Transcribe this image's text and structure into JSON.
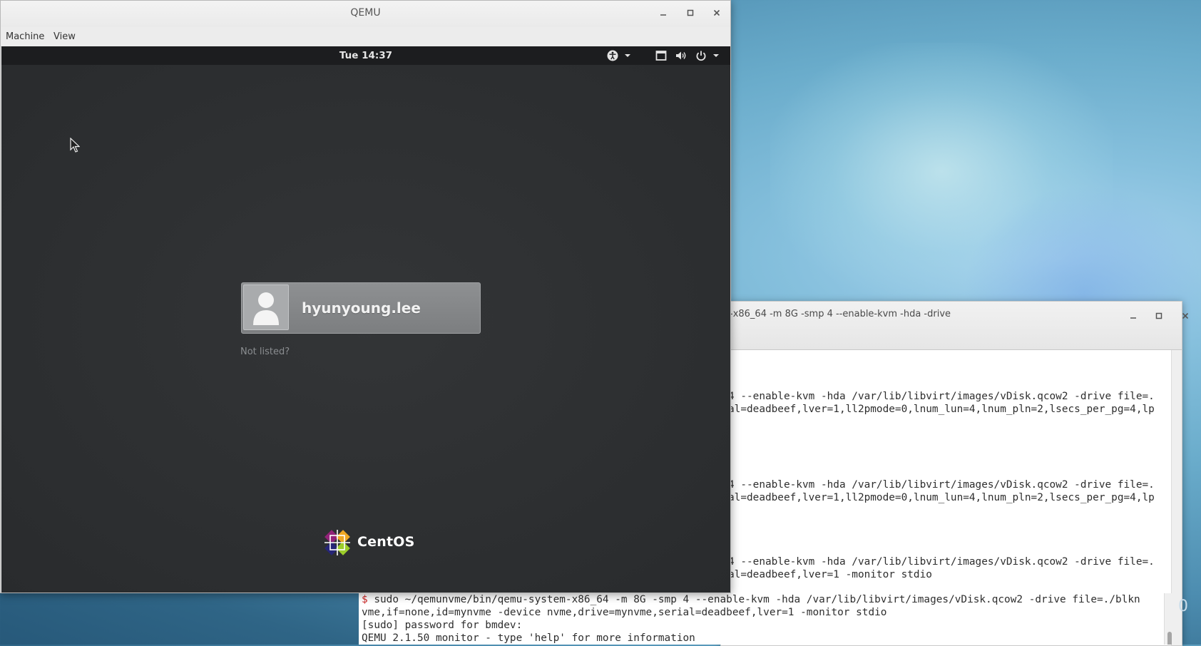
{
  "qemu": {
    "title": "QEMU",
    "menu": [
      "Machine",
      "View"
    ]
  },
  "guest": {
    "clock": "Tue 14:37",
    "user": "hyunyoung.lee",
    "not_listed": "Not listed?",
    "logo_text": "CentOS"
  },
  "terminal": {
    "title": "-x86_64 -m 8G -smp 4 --enable-kvm -hda  -drive",
    "lines": [
      "4 --enable-kvm -hda /var/lib/libvirt/images/vDisk.qcow2 -drive file=.",
      "al=deadbeef,lver=1,ll2pmode=0,lnum_lun=4,lnum_pln=2,lsecs_per_pg=4,lp",
      "4 --enable-kvm -hda /var/lib/libvirt/images/vDisk.qcow2 -drive file=.",
      "al=deadbeef,lver=1,ll2pmode=0,lnum_lun=4,lnum_pln=2,lsecs_per_pg=4,lp",
      "4 --enable-kvm -hda /var/lib/libvirt/images/vDisk.qcow2 -drive file=.",
      "al=deadbeef,lver=1 -monitor stdio"
    ],
    "bottom": {
      "prompt": "$",
      "cmd": " sudo ~/qemunvme/bin/qemu-system-x86_64 -m 8G -smp 4 --enable-kvm -hda /var/lib/libvirt/images/vDisk.qcow2 -drive file=./blkn",
      "cont": "vme,if=none,id=mynvme -device nvme,drive=mynvme,serial=deadbeef,lver=1 -monitor stdio",
      "sudo": "[sudo] password for bmdev:",
      "monitor": "QEMU 2.1.50 monitor - type 'help' for more information"
    },
    "edge_char": "0"
  },
  "colors": {
    "guest_bg": "#2d2f31",
    "top_bar": "#1c1d1f",
    "prompt": "#cc2222"
  }
}
